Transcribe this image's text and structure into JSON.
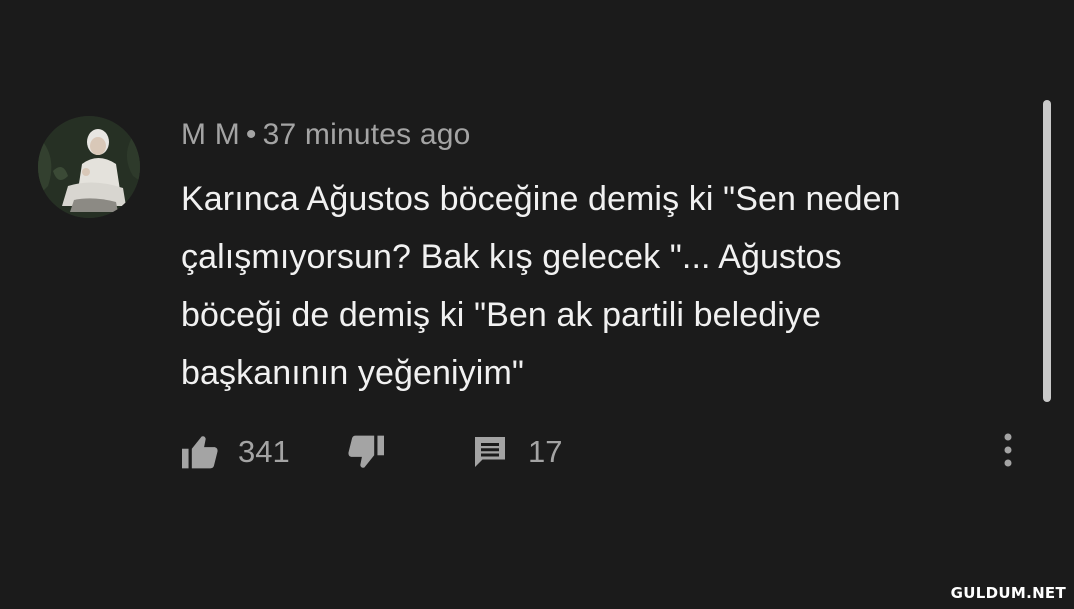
{
  "comment": {
    "author": "M M",
    "separator": "•",
    "time": "37 minutes ago",
    "text_lines": [
      "Karınca Ağustos böceğine demiş ki \"Sen neden",
      "çalışmıyorsun? Bak kış gelecek \"... Ağustos",
      "böceği de demiş ki \"Ben ak partili belediye",
      "başkanının yeğeniyim\""
    ],
    "likes": "341",
    "replies": "17"
  },
  "icons": {
    "like": "thumbs-up-icon",
    "dislike": "thumbs-down-icon",
    "reply": "comment-icon",
    "more": "more-vertical-icon"
  },
  "colors": {
    "background": "#1b1b1b",
    "text": "#f1f1f1",
    "secondary": "#a4a4a4"
  },
  "watermark": "GULDUM.NET"
}
